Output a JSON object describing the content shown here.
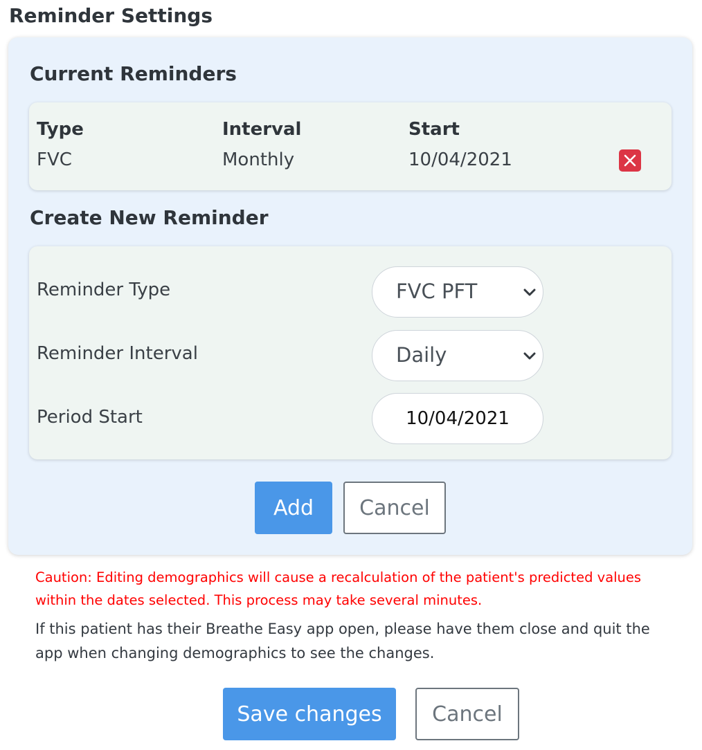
{
  "page_title": "Reminder Settings",
  "current": {
    "title": "Current Reminders",
    "headers": [
      "Type",
      "Interval",
      "Start"
    ],
    "rows": [
      {
        "type": "FVC",
        "interval": "Monthly",
        "start": "10/04/2021"
      }
    ],
    "delete_icon": "close-x",
    "delete_color": "#dc3545"
  },
  "create": {
    "title": "Create New Reminder",
    "type_label": "Reminder Type",
    "type_value": "FVC PFT",
    "interval_label": "Reminder Interval",
    "interval_value": "Daily",
    "start_label": "Period Start",
    "start_value": "10/04/2021",
    "add_label": "Add",
    "cancel_label": "Cancel"
  },
  "caution": "Caution: Editing demographics will cause a recalculation of the patient's predicted values within the dates selected. This process may take several minutes.",
  "info": "If this patient has their Breathe Easy app open, please have them close and quit the app when changing demographics to see the changes.",
  "footer": {
    "save_label": "Save changes",
    "cancel_label": "Cancel"
  },
  "colors": {
    "primary": "#4a97e8",
    "danger": "#dc3545",
    "caution_text": "#ff0000",
    "panel_bg": "#e9f2fc",
    "card_bg": "#eff5f2"
  }
}
